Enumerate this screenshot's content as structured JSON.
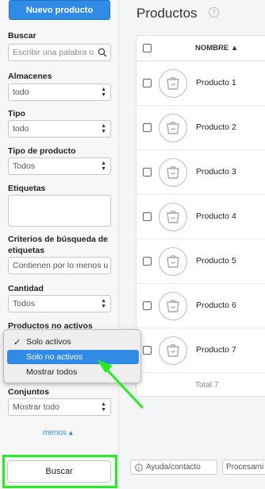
{
  "sidebar": {
    "new_product": "Nuevo producto",
    "search_label": "Buscar",
    "search_placeholder": "Escribir una palabra o",
    "almacenes_label": "Almacenes",
    "almacenes_value": "todo",
    "tipo_label": "Tipo",
    "tipo_value": "todo",
    "tipo_producto_label": "Tipo de producto",
    "tipo_producto_value": "Todos",
    "etiquetas_label": "Etiquetas",
    "criterios_label": "Criterios de búsqueda de etiquetas",
    "criterios_value": "Contienen por lo menos u",
    "cantidad_label": "Cantidad",
    "cantidad_value": "Todos",
    "no_activos_label": "Productos no activos",
    "no_activos_options": [
      "Solo activos",
      "Solo no activos",
      "Mostrar todos"
    ],
    "conjuntos_label": "Conjuntos",
    "conjuntos_value": "Mostrar todo",
    "menos_link": "menos ▴",
    "buscar_button": "Buscar"
  },
  "main": {
    "title": "Productos",
    "help": "?",
    "column_nombre": "NOMBRE ▲",
    "products": [
      "Producto 1",
      "Producto 2",
      "Producto 3",
      "Producto 4",
      "Producto 5",
      "Producto 6",
      "Producto 7"
    ],
    "total": "Total 7"
  },
  "bottom": {
    "help_contact": "Ayuda/contacto",
    "procesamiento": "Procesami"
  },
  "colors": {
    "accent": "#2f8be6",
    "highlight": "#22ee22"
  }
}
